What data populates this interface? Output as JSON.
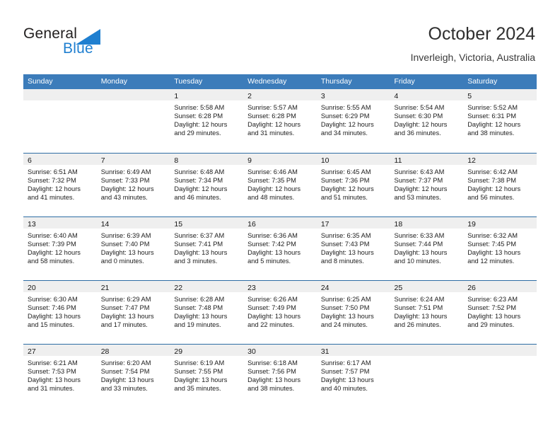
{
  "brand": {
    "name_part1": "General",
    "name_part2": "Blue",
    "triangle_color": "#1f7fd0",
    "text_color": "#221f1f"
  },
  "header": {
    "title": "October 2024",
    "subtitle": "Inverleigh, Victoria, Australia"
  },
  "theme": {
    "header_row_bg": "#3c7cba",
    "header_row_text": "#ffffff",
    "row_divider": "#2e6da4",
    "date_band_bg": "#efefef",
    "cell_bg": "#ffffff"
  },
  "weekdays": [
    "Sunday",
    "Monday",
    "Tuesday",
    "Wednesday",
    "Thursday",
    "Friday",
    "Saturday"
  ],
  "weeks": [
    [
      {
        "day": "",
        "lines": []
      },
      {
        "day": "",
        "lines": []
      },
      {
        "day": "1",
        "lines": [
          "Sunrise: 5:58 AM",
          "Sunset: 6:28 PM",
          "Daylight: 12 hours",
          "and 29 minutes."
        ]
      },
      {
        "day": "2",
        "lines": [
          "Sunrise: 5:57 AM",
          "Sunset: 6:28 PM",
          "Daylight: 12 hours",
          "and 31 minutes."
        ]
      },
      {
        "day": "3",
        "lines": [
          "Sunrise: 5:55 AM",
          "Sunset: 6:29 PM",
          "Daylight: 12 hours",
          "and 34 minutes."
        ]
      },
      {
        "day": "4",
        "lines": [
          "Sunrise: 5:54 AM",
          "Sunset: 6:30 PM",
          "Daylight: 12 hours",
          "and 36 minutes."
        ]
      },
      {
        "day": "5",
        "lines": [
          "Sunrise: 5:52 AM",
          "Sunset: 6:31 PM",
          "Daylight: 12 hours",
          "and 38 minutes."
        ]
      }
    ],
    [
      {
        "day": "6",
        "lines": [
          "Sunrise: 6:51 AM",
          "Sunset: 7:32 PM",
          "Daylight: 12 hours",
          "and 41 minutes."
        ]
      },
      {
        "day": "7",
        "lines": [
          "Sunrise: 6:49 AM",
          "Sunset: 7:33 PM",
          "Daylight: 12 hours",
          "and 43 minutes."
        ]
      },
      {
        "day": "8",
        "lines": [
          "Sunrise: 6:48 AM",
          "Sunset: 7:34 PM",
          "Daylight: 12 hours",
          "and 46 minutes."
        ]
      },
      {
        "day": "9",
        "lines": [
          "Sunrise: 6:46 AM",
          "Sunset: 7:35 PM",
          "Daylight: 12 hours",
          "and 48 minutes."
        ]
      },
      {
        "day": "10",
        "lines": [
          "Sunrise: 6:45 AM",
          "Sunset: 7:36 PM",
          "Daylight: 12 hours",
          "and 51 minutes."
        ]
      },
      {
        "day": "11",
        "lines": [
          "Sunrise: 6:43 AM",
          "Sunset: 7:37 PM",
          "Daylight: 12 hours",
          "and 53 minutes."
        ]
      },
      {
        "day": "12",
        "lines": [
          "Sunrise: 6:42 AM",
          "Sunset: 7:38 PM",
          "Daylight: 12 hours",
          "and 56 minutes."
        ]
      }
    ],
    [
      {
        "day": "13",
        "lines": [
          "Sunrise: 6:40 AM",
          "Sunset: 7:39 PM",
          "Daylight: 12 hours",
          "and 58 minutes."
        ]
      },
      {
        "day": "14",
        "lines": [
          "Sunrise: 6:39 AM",
          "Sunset: 7:40 PM",
          "Daylight: 13 hours",
          "and 0 minutes."
        ]
      },
      {
        "day": "15",
        "lines": [
          "Sunrise: 6:37 AM",
          "Sunset: 7:41 PM",
          "Daylight: 13 hours",
          "and 3 minutes."
        ]
      },
      {
        "day": "16",
        "lines": [
          "Sunrise: 6:36 AM",
          "Sunset: 7:42 PM",
          "Daylight: 13 hours",
          "and 5 minutes."
        ]
      },
      {
        "day": "17",
        "lines": [
          "Sunrise: 6:35 AM",
          "Sunset: 7:43 PM",
          "Daylight: 13 hours",
          "and 8 minutes."
        ]
      },
      {
        "day": "18",
        "lines": [
          "Sunrise: 6:33 AM",
          "Sunset: 7:44 PM",
          "Daylight: 13 hours",
          "and 10 minutes."
        ]
      },
      {
        "day": "19",
        "lines": [
          "Sunrise: 6:32 AM",
          "Sunset: 7:45 PM",
          "Daylight: 13 hours",
          "and 12 minutes."
        ]
      }
    ],
    [
      {
        "day": "20",
        "lines": [
          "Sunrise: 6:30 AM",
          "Sunset: 7:46 PM",
          "Daylight: 13 hours",
          "and 15 minutes."
        ]
      },
      {
        "day": "21",
        "lines": [
          "Sunrise: 6:29 AM",
          "Sunset: 7:47 PM",
          "Daylight: 13 hours",
          "and 17 minutes."
        ]
      },
      {
        "day": "22",
        "lines": [
          "Sunrise: 6:28 AM",
          "Sunset: 7:48 PM",
          "Daylight: 13 hours",
          "and 19 minutes."
        ]
      },
      {
        "day": "23",
        "lines": [
          "Sunrise: 6:26 AM",
          "Sunset: 7:49 PM",
          "Daylight: 13 hours",
          "and 22 minutes."
        ]
      },
      {
        "day": "24",
        "lines": [
          "Sunrise: 6:25 AM",
          "Sunset: 7:50 PM",
          "Daylight: 13 hours",
          "and 24 minutes."
        ]
      },
      {
        "day": "25",
        "lines": [
          "Sunrise: 6:24 AM",
          "Sunset: 7:51 PM",
          "Daylight: 13 hours",
          "and 26 minutes."
        ]
      },
      {
        "day": "26",
        "lines": [
          "Sunrise: 6:23 AM",
          "Sunset: 7:52 PM",
          "Daylight: 13 hours",
          "and 29 minutes."
        ]
      }
    ],
    [
      {
        "day": "27",
        "lines": [
          "Sunrise: 6:21 AM",
          "Sunset: 7:53 PM",
          "Daylight: 13 hours",
          "and 31 minutes."
        ]
      },
      {
        "day": "28",
        "lines": [
          "Sunrise: 6:20 AM",
          "Sunset: 7:54 PM",
          "Daylight: 13 hours",
          "and 33 minutes."
        ]
      },
      {
        "day": "29",
        "lines": [
          "Sunrise: 6:19 AM",
          "Sunset: 7:55 PM",
          "Daylight: 13 hours",
          "and 35 minutes."
        ]
      },
      {
        "day": "30",
        "lines": [
          "Sunrise: 6:18 AM",
          "Sunset: 7:56 PM",
          "Daylight: 13 hours",
          "and 38 minutes."
        ]
      },
      {
        "day": "31",
        "lines": [
          "Sunrise: 6:17 AM",
          "Sunset: 7:57 PM",
          "Daylight: 13 hours",
          "and 40 minutes."
        ]
      },
      {
        "day": "",
        "lines": []
      },
      {
        "day": "",
        "lines": []
      }
    ]
  ]
}
